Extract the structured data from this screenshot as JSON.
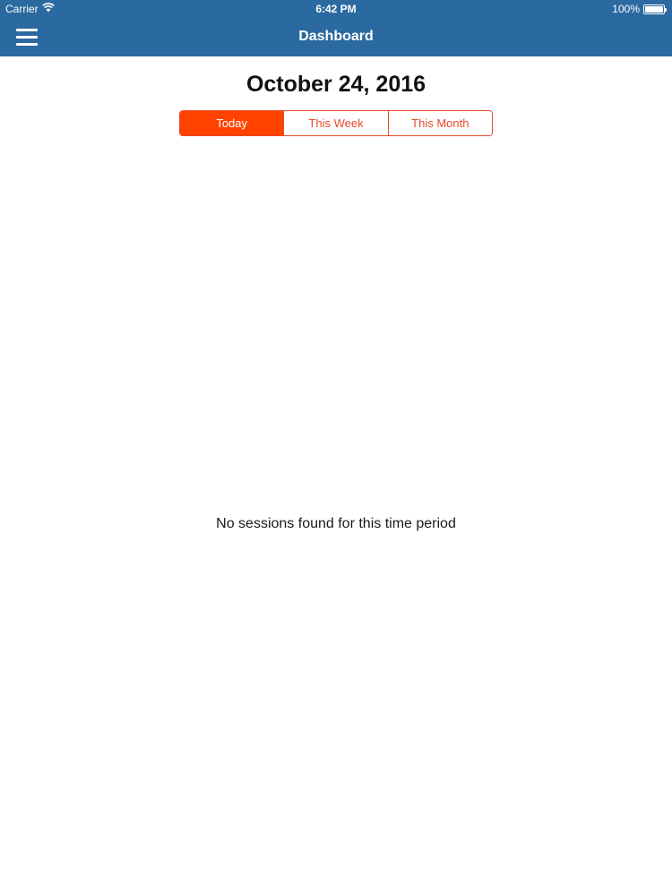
{
  "status_bar": {
    "carrier": "Carrier",
    "time": "6:42 PM",
    "battery_text": "100%",
    "battery_level": 1.0
  },
  "nav": {
    "title": "Dashboard",
    "menu_icon": "hamburger-menu-icon"
  },
  "date_title": "October 24, 2016",
  "segments": {
    "selected": "Today",
    "items": [
      "Today",
      "This Week",
      "This Month"
    ]
  },
  "empty_message": "No sessions found for this time period",
  "colors": {
    "header": "#2b6aa0",
    "accent": "#ff4200",
    "segment_border": "#e84a2a"
  }
}
